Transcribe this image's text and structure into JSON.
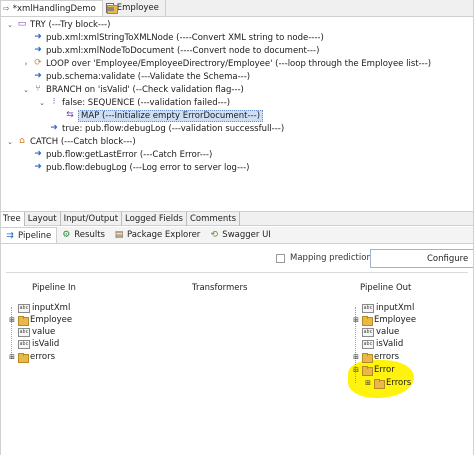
{
  "editor_tabs": [
    {
      "label": "*xmlHandlingDemo",
      "icon": "flow-service-arrow-icon",
      "active": true
    },
    {
      "label": "Employee",
      "icon": "document-type-icon",
      "active": false
    }
  ],
  "flow": [
    {
      "label": "TRY (---Try block---)",
      "icon": "try-icon",
      "chevron": "v"
    },
    {
      "label": "pub.xml:xmlStringToXMLNode (----Convert XML string to node----)",
      "icon": "invoke-icon",
      "chevron": ""
    },
    {
      "label": "pub.xml:xmlNodeToDocument (----Convert node to document---)",
      "icon": "invoke-icon",
      "chevron": ""
    },
    {
      "label": "LOOP over 'Employee/EmployeeDirectrory/Employee' (---loop through the Employee list---)",
      "icon": "loop-icon",
      "chevron": ">"
    },
    {
      "label": "pub.schema:validate (---Validate the Schema---)",
      "icon": "invoke-icon",
      "chevron": ""
    },
    {
      "label": "BRANCH on 'isValid' (--Check validation flag---)",
      "icon": "branch-icon",
      "chevron": "v"
    },
    {
      "label": "false: SEQUENCE (---validation failed---)",
      "icon": "sequence-icon",
      "chevron": "v"
    },
    {
      "label": "MAP (---Initialize empty ErrorDocument---)",
      "icon": "map-icon",
      "chevron": ""
    },
    {
      "label": "true: pub.flow:debugLog (---validation successfull---)",
      "icon": "invoke-icon",
      "chevron": ""
    },
    {
      "label": "CATCH (---Catch block---)",
      "icon": "catch-icon",
      "chevron": "v"
    },
    {
      "label": "pub.flow:getLastError (---Catch Error---)",
      "icon": "invoke-icon",
      "chevron": ""
    },
    {
      "label": "pub.flow:debugLog (---Log error to server log---)",
      "icon": "invoke-icon",
      "chevron": ""
    }
  ],
  "view_tabs": [
    "Tree",
    "Layout",
    "Input/Output",
    "Logged Fields",
    "Comments"
  ],
  "panel_tabs": [
    {
      "label": "Pipeline",
      "icon": "pipeline-icon",
      "active": true
    },
    {
      "label": "Results",
      "icon": "results-icon",
      "active": false
    },
    {
      "label": "Package Explorer",
      "icon": "package-explorer-icon",
      "active": false
    },
    {
      "label": "Swagger UI",
      "icon": "swagger-icon",
      "active": false
    }
  ],
  "pipeline": {
    "mapping_predictions_label": "Mapping predictions",
    "configure_label": "Configure",
    "columns": {
      "in": "Pipeline In",
      "transformers": "Transformers",
      "out": "Pipeline Out"
    },
    "pipeline_in": [
      {
        "label": "inputXml",
        "type": "string"
      },
      {
        "label": "Employee",
        "type": "document"
      },
      {
        "label": "value",
        "type": "string"
      },
      {
        "label": "isValid",
        "type": "string"
      },
      {
        "label": "errors",
        "type": "document"
      }
    ],
    "pipeline_out": [
      {
        "label": "inputXml",
        "type": "string"
      },
      {
        "label": "Employee",
        "type": "document"
      },
      {
        "label": "value",
        "type": "string"
      },
      {
        "label": "isValid",
        "type": "string"
      },
      {
        "label": "errors",
        "type": "document"
      },
      {
        "label": "Error",
        "type": "document"
      },
      {
        "label": "Errors",
        "type": "document"
      }
    ],
    "highlight_color": "#fff200"
  }
}
